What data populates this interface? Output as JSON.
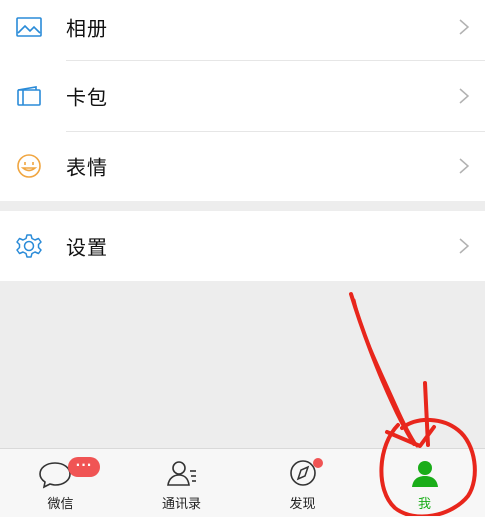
{
  "menu": {
    "items": [
      {
        "label": "相册",
        "icon": "photo-album-icon"
      },
      {
        "label": "卡包",
        "icon": "card-wallet-icon"
      },
      {
        "label": "表情",
        "icon": "emoji-smile-icon"
      }
    ],
    "settings": {
      "label": "设置",
      "icon": "gear-icon"
    }
  },
  "tabbar": {
    "tabs": [
      {
        "label": "微信",
        "icon": "chat-bubble-icon",
        "badge": "···"
      },
      {
        "label": "通讯录",
        "icon": "contacts-icon"
      },
      {
        "label": "发现",
        "icon": "compass-icon"
      },
      {
        "label": "我",
        "icon": "person-icon",
        "active": true
      }
    ]
  },
  "colors": {
    "accent_blue": "#2a8bd8",
    "active_green": "#1aad19",
    "badge_red": "#f05454",
    "annotation_red": "#e8261c"
  }
}
